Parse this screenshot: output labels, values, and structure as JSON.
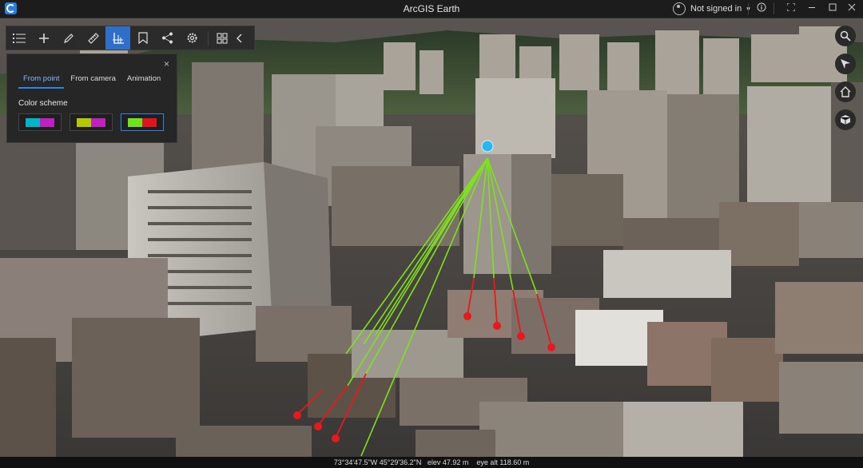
{
  "titlebar": {
    "title": "ArcGIS Earth",
    "signin_label": "Not signed in",
    "signin_caret": "▾",
    "info_icon": "info-icon",
    "buttons": [
      "restore-icon",
      "minimize-icon",
      "maximize-icon",
      "close-icon"
    ]
  },
  "toolbar": {
    "tools": [
      "list-icon",
      "add-icon",
      "draw-icon",
      "measure-icon",
      "analysis-icon",
      "bookmark-icon",
      "share-icon",
      "settings-icon",
      "grid-icon",
      "collapse-icon"
    ],
    "active_tool": "analysis-icon"
  },
  "panel": {
    "close_glyph": "×",
    "tabs": [
      "From point",
      "From camera",
      "Animation"
    ],
    "active_tab": "From point",
    "color_scheme_label": "Color scheme",
    "schemes": [
      {
        "a": "#00b4c8",
        "b": "#c21fc1"
      },
      {
        "a": "#b4c800",
        "b": "#c21fc1"
      },
      {
        "a": "#6fe21a",
        "b": "#e0141e"
      }
    ],
    "selected_scheme": 2
  },
  "right_controls": [
    "search-icon",
    "navigate-icon",
    "home-icon",
    "cube-icon"
  ],
  "status": {
    "coords": "73°34'47.5\"W 45°29'36.2\"N",
    "elev": "elev 47.92 m",
    "eye_alt": "eye alt 118.60 m"
  },
  "colors": {
    "visible": "#7ee21c",
    "hidden": "#e8191c",
    "observer": "#27b7f0",
    "accent": "#2f6fc7"
  }
}
